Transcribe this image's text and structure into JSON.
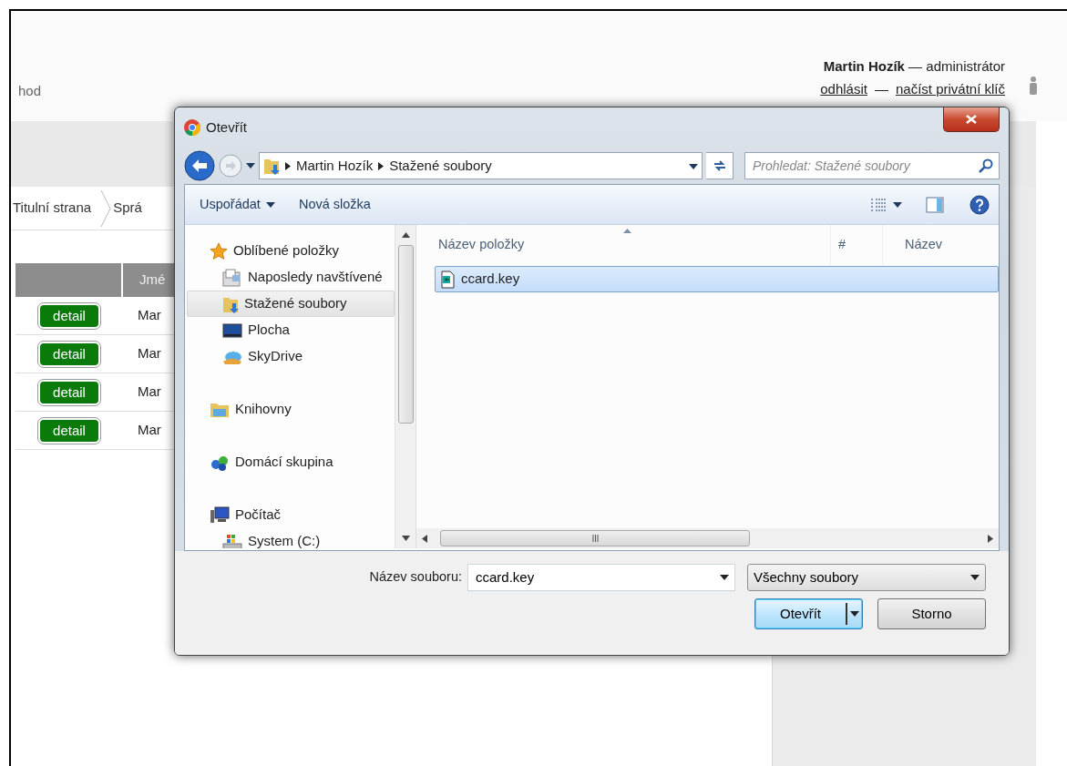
{
  "page": {
    "header_text": "hod",
    "user": {
      "line": "**Martin Hozík** — administrátor",
      "logout": "odhlásit",
      "separator": "—",
      "key_link": "načíst privátní klíč"
    },
    "breadcrumbs": [
      "Titulní strana",
      "Sprá"
    ],
    "table": {
      "column_2": "Jmé",
      "rows": [
        {
          "action": "detail",
          "column_2": "Mar"
        },
        {
          "action": "detail",
          "column_2": "Mar"
        },
        {
          "action": "detail",
          "column_2": "Mar"
        },
        {
          "action": "detail",
          "column_2": "Mar"
        }
      ]
    }
  },
  "dialog": {
    "title": "Otevřít",
    "address": [
      "Martin Hozík",
      "Stažené soubory"
    ],
    "search": {
      "placeholder": "Prohledat: Stažené soubory"
    },
    "toolbar": [
      {
        "label": "Uspořádat",
        "dropdown": true
      },
      {
        "label": "Nová složka",
        "dropdown": false
      }
    ],
    "nav": [
      {
        "label": "Oblíbené položky",
        "selected": false,
        "children": [
          {
            "label": "Naposledy navštívené",
            "selected": false
          },
          {
            "label": "Stažené soubory",
            "selected": true
          },
          {
            "label": "Plocha",
            "selected": false
          },
          {
            "label": "SkyDrive",
            "selected": false
          }
        ]
      },
      {
        "label": "Knihovny",
        "selected": false
      },
      {
        "label": "Domácí skupina",
        "selected": false
      },
      {
        "label": "Počítač",
        "selected": false,
        "children": [
          {
            "label": "System (C:)",
            "selected": false
          }
        ]
      }
    ],
    "columns": [
      {
        "label": "Název položky",
        "sorted": true
      },
      {
        "label": "#",
        "sorted": false
      },
      {
        "label": "Název",
        "sorted": false
      }
    ],
    "files": [
      {
        "name": "ccard.key",
        "selected": true
      }
    ],
    "filename": {
      "label": "Název souboru:",
      "value": "ccard.key"
    },
    "filter": "Všechny soubory",
    "buttons": [
      {
        "label": "Otevřít",
        "default": true,
        "split": true
      },
      {
        "label": "Storno",
        "default": false,
        "split": false
      }
    ]
  }
}
